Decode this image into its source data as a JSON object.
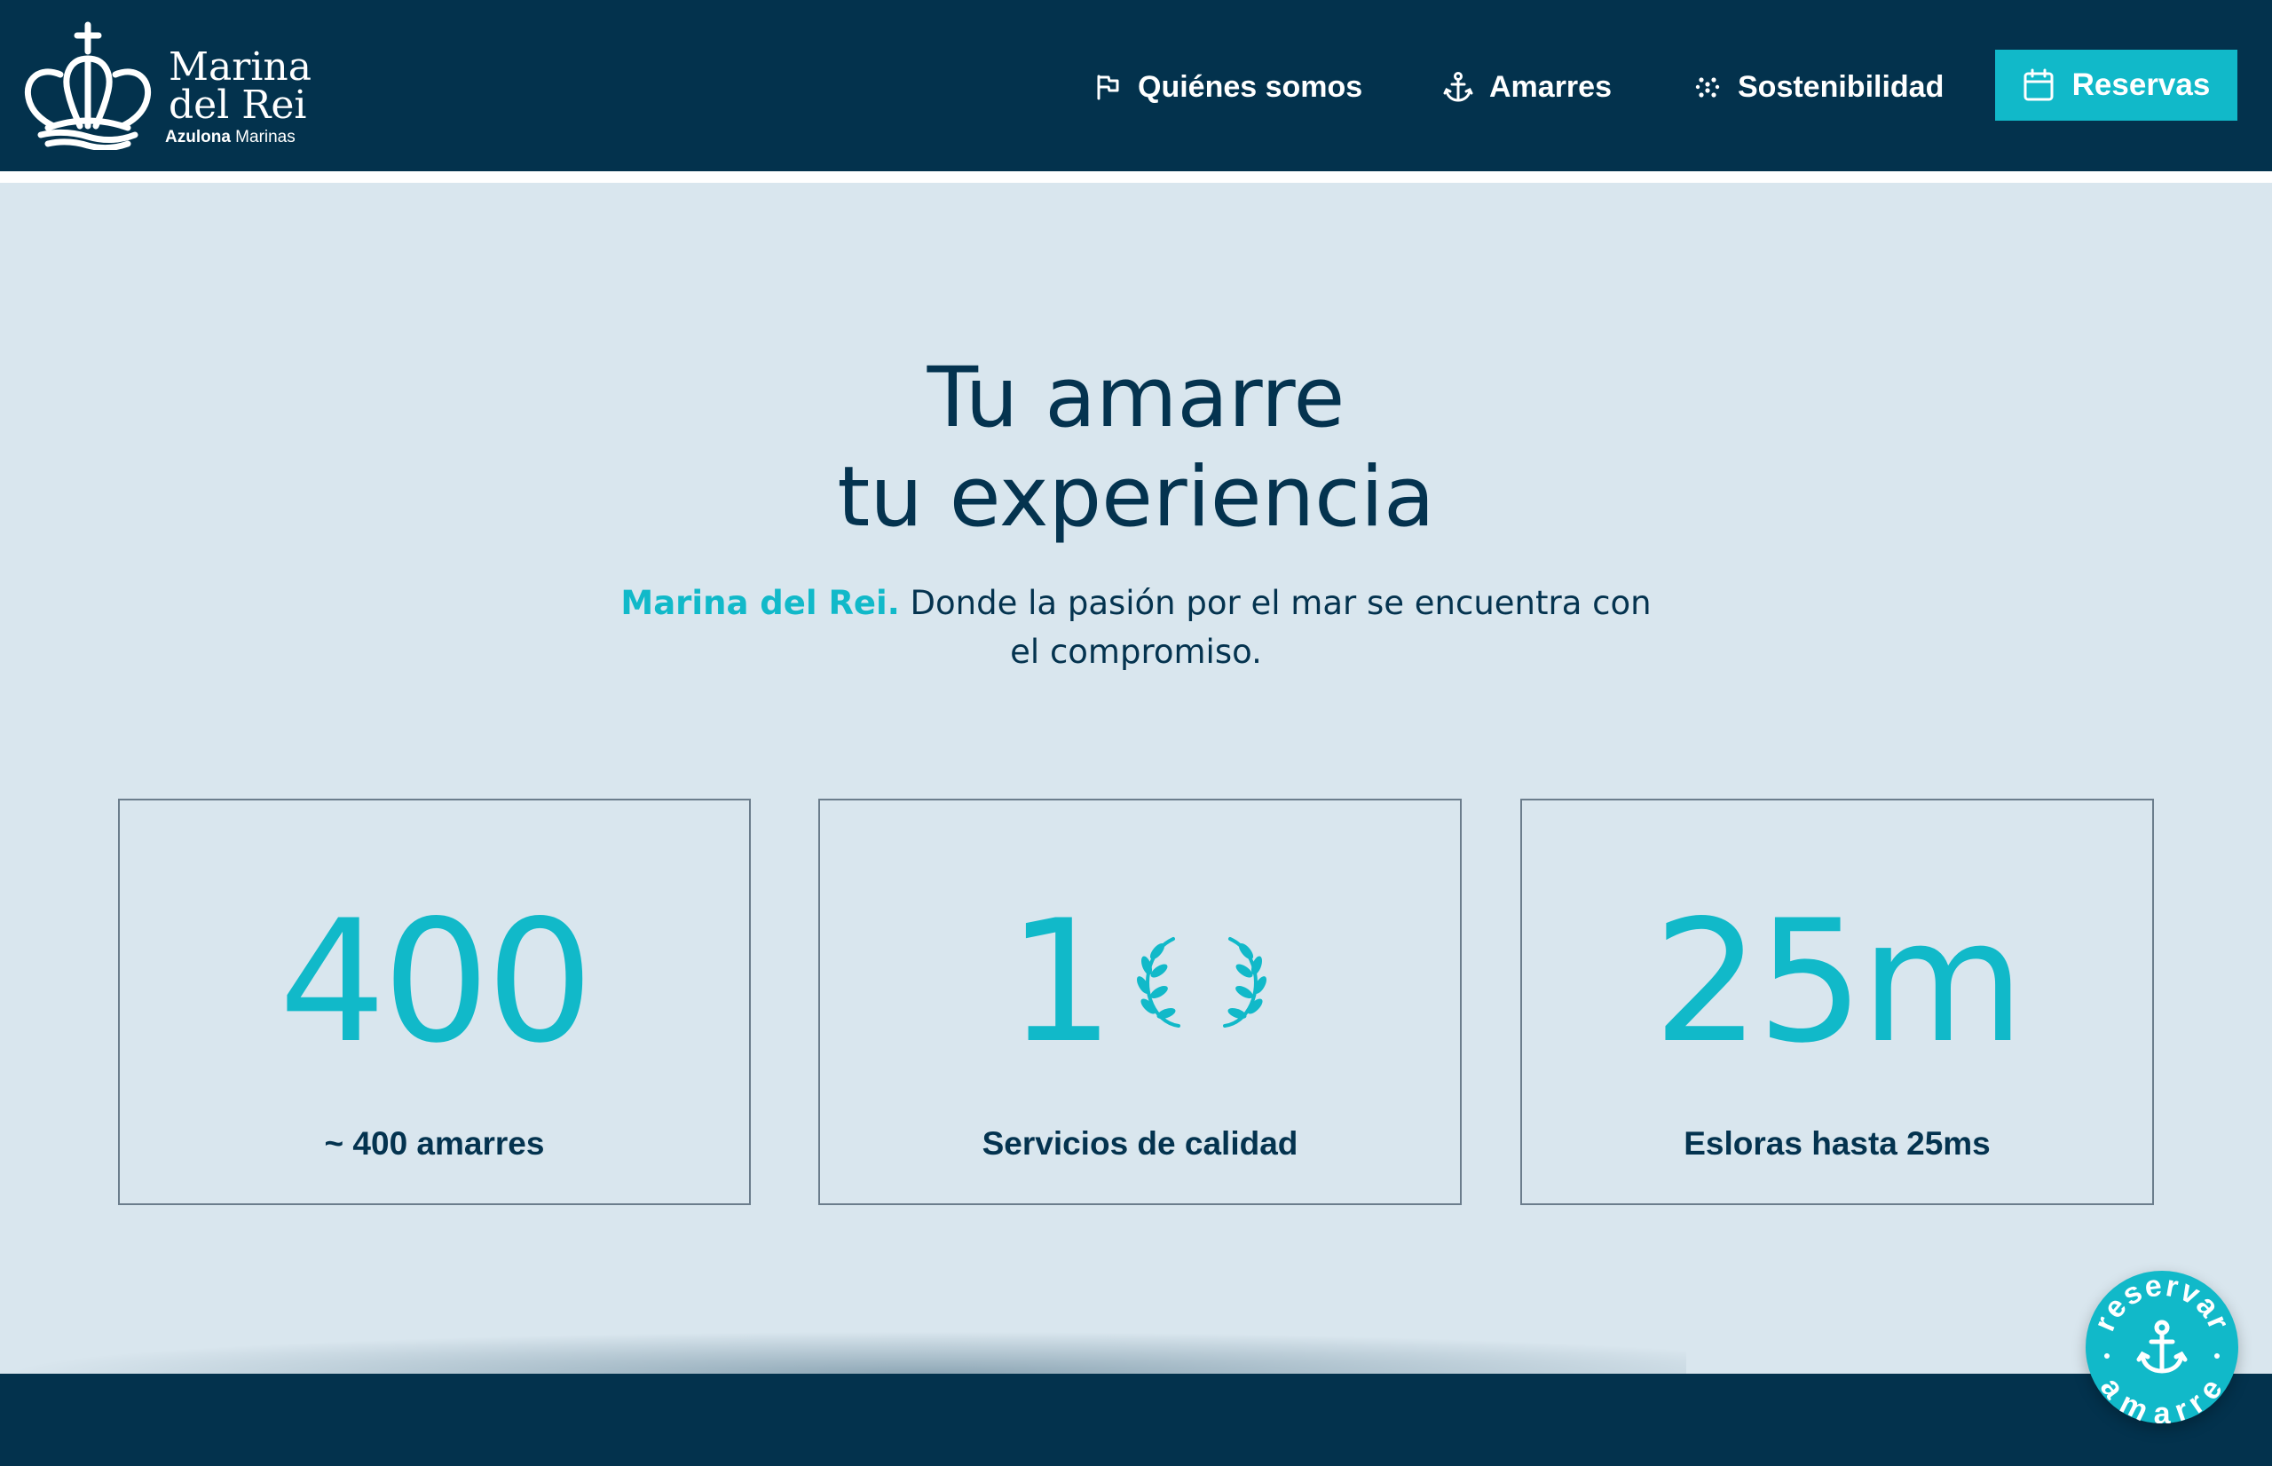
{
  "header": {
    "logo": {
      "line1": "Marina",
      "line2": "del Rei",
      "sub_bold": "Azulona",
      "sub_rest": " Marinas"
    },
    "nav": [
      {
        "label": "Quiénes somos",
        "icon": "flag-icon"
      },
      {
        "label": "Amarres",
        "icon": "anchor-icon"
      },
      {
        "label": "Sostenibilidad",
        "icon": "sparkle-dots-icon"
      }
    ],
    "cta": {
      "label": "Reservas",
      "icon": "calendar-icon"
    }
  },
  "hero": {
    "title_line1": "Tu amarre",
    "title_line2": "tu experiencia",
    "subtitle_brand": "Marina del Rei.",
    "subtitle_rest": " Donde la pasión por el mar se encuentra con el compromiso."
  },
  "stats": [
    {
      "value": "400",
      "label": "~ 400 amarres"
    },
    {
      "value": "1",
      "icon": "laurel-wreath-icon",
      "label": "Servicios de calidad"
    },
    {
      "value": "25m",
      "label": "Esloras hasta 25ms"
    }
  ],
  "badge": {
    "top_text": "reservar",
    "bottom_text": "amarre",
    "icon": "anchor-icon"
  },
  "colors": {
    "navy": "#03324d",
    "accent": "#11b9c9",
    "background": "#d9e6ee",
    "text": "#04334f"
  }
}
